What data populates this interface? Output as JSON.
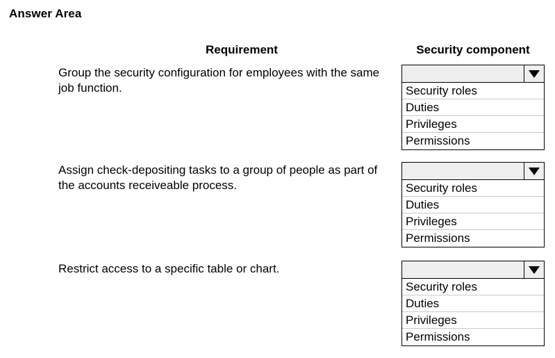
{
  "page": {
    "title": "Answer Area"
  },
  "table": {
    "headers": {
      "requirement": "Requirement",
      "security_component": "Security component"
    },
    "rows": [
      {
        "requirement": "Group the security configuration for employees with the same job function.",
        "dropdown": {
          "selected": "",
          "arrow_icon": "chevron-down-icon",
          "options": [
            "Security roles",
            "Duties",
            "Privileges",
            "Permissions"
          ]
        }
      },
      {
        "requirement": "Assign check-depositing tasks to a group of people as part of the accounts receiveable process.",
        "dropdown": {
          "selected": "",
          "arrow_icon": "chevron-down-icon",
          "options": [
            "Security roles",
            "Duties",
            "Privileges",
            "Permissions"
          ]
        }
      },
      {
        "requirement": "Restrict access to a specific table or chart.",
        "dropdown": {
          "selected": "",
          "arrow_icon": "chevron-down-icon",
          "options": [
            "Security roles",
            "Duties",
            "Privileges",
            "Permissions"
          ]
        }
      }
    ]
  },
  "colors": {
    "field_background": "#efefef",
    "option_background": "#ffffff",
    "border": "#000000",
    "option_separator": "#c9c9c9",
    "text": "#000000"
  }
}
